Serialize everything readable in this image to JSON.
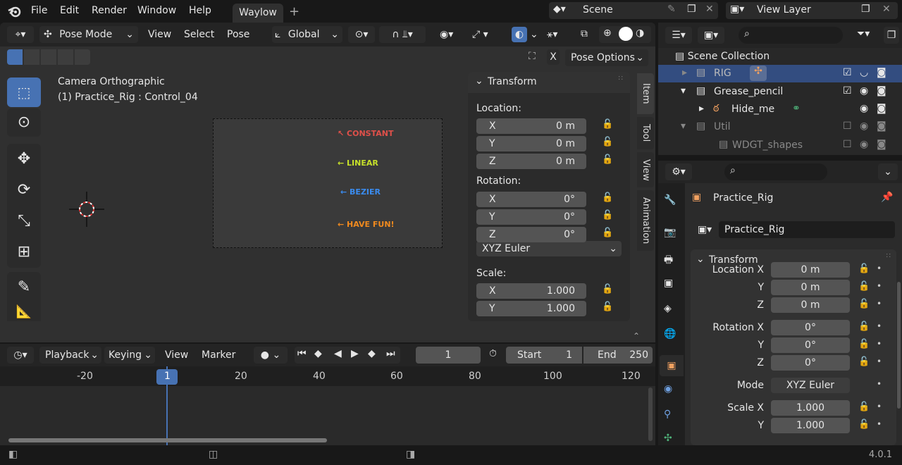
{
  "topbar": {
    "menus": [
      "File",
      "Edit",
      "Render",
      "Window",
      "Help"
    ],
    "workspace_tab": "Waylow",
    "scene_label": "Scene",
    "view_layer_label": "View Layer"
  },
  "viewport_header": {
    "mode": "Pose Mode",
    "menus": [
      "View",
      "Select",
      "Pose"
    ],
    "transform_orientation": "Global",
    "pose_options": "Pose Options",
    "x_label": "X"
  },
  "viewport": {
    "camera_label": "Camera Orthographic",
    "object_label": "(1) Practice_Rig : Control_04",
    "annotations": [
      "CONSTANT",
      "LINEAR",
      "BEZIER",
      "HAVE FUN!"
    ],
    "annotation_colors": [
      "#e0504a",
      "#c6e02a",
      "#3a8cf0",
      "#f08a1e"
    ]
  },
  "npanel": {
    "header": "Transform",
    "location_label": "Location:",
    "location": [
      {
        "axis": "X",
        "value": "0 m"
      },
      {
        "axis": "Y",
        "value": "0 m"
      },
      {
        "axis": "Z",
        "value": "0 m"
      }
    ],
    "rotation_label": "Rotation:",
    "rotation": [
      {
        "axis": "X",
        "value": "0°"
      },
      {
        "axis": "Y",
        "value": "0°"
      },
      {
        "axis": "Z",
        "value": "0°"
      }
    ],
    "rotation_mode": "XYZ Euler",
    "scale_label": "Scale:",
    "scale": [
      {
        "axis": "X",
        "value": "1.000"
      },
      {
        "axis": "Y",
        "value": "1.000"
      }
    ],
    "tabs": [
      "Item",
      "Tool",
      "View",
      "Animation"
    ]
  },
  "timeline": {
    "menus": [
      "Playback",
      "Keying",
      "View",
      "Marker"
    ],
    "current_frame": "1",
    "start_label": "Start",
    "start_value": "1",
    "end_label": "End",
    "end_value": "250",
    "ruler": [
      "-20",
      "1",
      "20",
      "40",
      "60",
      "80",
      "100",
      "120"
    ]
  },
  "outliner": {
    "items": [
      {
        "name": "Scene Collection"
      },
      {
        "name": "RIG"
      },
      {
        "name": "Grease_pencil"
      },
      {
        "name": "Hide_me"
      },
      {
        "name": "Util"
      },
      {
        "name": "WDGT_shapes"
      }
    ]
  },
  "properties": {
    "object_name": "Practice_Rig",
    "data_name": "Practice_Rig",
    "transform_header": "Transform",
    "rows": [
      {
        "label": "Location X",
        "value": "0 m"
      },
      {
        "label": "Y",
        "value": "0 m"
      },
      {
        "label": "Z",
        "value": "0 m"
      },
      {
        "label": "Rotation X",
        "value": "0°"
      },
      {
        "label": "Y",
        "value": "0°"
      },
      {
        "label": "Z",
        "value": "0°"
      },
      {
        "label": "Mode",
        "value": "XYZ Euler"
      },
      {
        "label": "Scale X",
        "value": "1.000"
      },
      {
        "label": "Y",
        "value": "1.000"
      }
    ]
  },
  "statusbar": {
    "version": "4.0.1"
  }
}
